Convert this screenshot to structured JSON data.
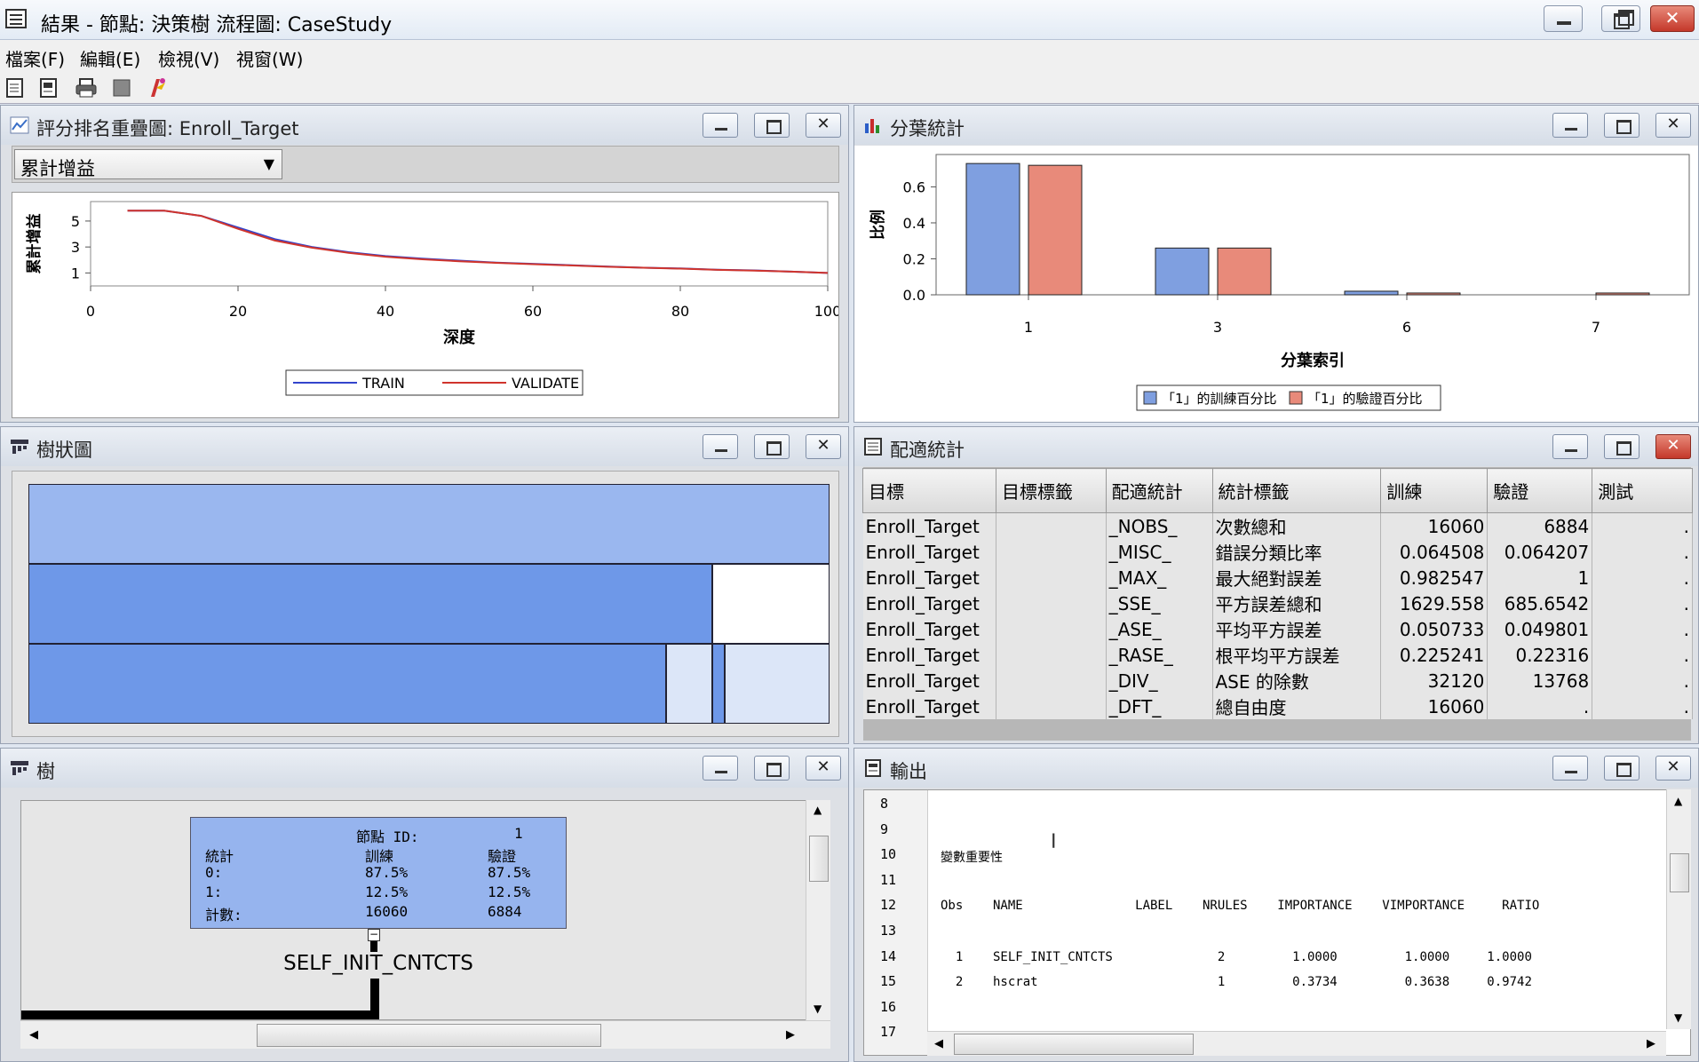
{
  "app": {
    "title": "結果 - 節點: 決策樹  流程圖: CaseStudy"
  },
  "menu": [
    "檔案(F)",
    "編輯(E)",
    "檢視(V)",
    "視窗(W)"
  ],
  "panels": {
    "lift": {
      "title": "評分排名重疊圖: Enroll_Target",
      "dropdown": "累計增益",
      "chart_data": {
        "type": "line",
        "xlabel": "深度",
        "ylabel": "累計增益",
        "x": [
          5,
          10,
          15,
          20,
          25,
          30,
          35,
          40,
          45,
          50,
          55,
          60,
          65,
          70,
          75,
          80,
          85,
          90,
          95,
          100
        ],
        "series": [
          {
            "name": "TRAIN",
            "color": "#3344cc",
            "values": [
              5.8,
              5.8,
              5.4,
              4.5,
              3.6,
              3.0,
              2.6,
              2.3,
              2.1,
              1.95,
              1.8,
              1.7,
              1.6,
              1.5,
              1.4,
              1.35,
              1.25,
              1.2,
              1.1,
              1.0
            ]
          },
          {
            "name": "VALIDATE",
            "color": "#d0342c",
            "values": [
              5.8,
              5.8,
              5.4,
              4.4,
              3.5,
              2.95,
              2.55,
              2.25,
              2.05,
              1.9,
              1.78,
              1.68,
              1.58,
              1.48,
              1.4,
              1.33,
              1.24,
              1.18,
              1.1,
              1.0
            ]
          }
        ],
        "xticks": [
          "0",
          "20",
          "40",
          "60",
          "80",
          "100"
        ],
        "yticks": [
          "1",
          "3",
          "5"
        ],
        "xlim": [
          0,
          100
        ],
        "ylim": [
          0,
          6.5
        ]
      }
    },
    "leaf": {
      "title": "分葉統計",
      "chart_data": {
        "type": "bar",
        "xlabel": "分葉索引",
        "ylabel": "比例",
        "categories": [
          "1",
          "3",
          "6",
          "7"
        ],
        "series": [
          {
            "name": "「1」的訓練百分比",
            "color": "#7f9fe0",
            "values": [
              0.73,
              0.26,
              0.02,
              0.0
            ]
          },
          {
            "name": "「1」的驗證百分比",
            "color": "#e88a7a",
            "values": [
              0.72,
              0.26,
              0.01,
              0.01
            ]
          }
        ],
        "yticks": [
          "0.0",
          "0.2",
          "0.4",
          "0.6"
        ],
        "ylim": [
          0,
          0.78
        ]
      }
    },
    "treemap": {
      "title": "樹狀圖"
    },
    "fit": {
      "title": "配適統計",
      "columns": [
        "目標",
        "目標標籤",
        "配適統計",
        "統計標籤",
        "訓練",
        "驗證",
        "測試"
      ],
      "rows": [
        [
          "Enroll_Target",
          "",
          "_NOBS_",
          "次數總和",
          "16060",
          "6884",
          "."
        ],
        [
          "Enroll_Target",
          "",
          "_MISC_",
          "錯誤分類比率",
          "0.064508",
          "0.064207",
          "."
        ],
        [
          "Enroll_Target",
          "",
          "_MAX_",
          "最大絕對誤差",
          "0.982547",
          "1",
          "."
        ],
        [
          "Enroll_Target",
          "",
          "_SSE_",
          "平方誤差總和",
          "1629.558",
          "685.6542",
          "."
        ],
        [
          "Enroll_Target",
          "",
          "_ASE_",
          "平均平方誤差",
          "0.050733",
          "0.049801",
          "."
        ],
        [
          "Enroll_Target",
          "",
          "_RASE_",
          "根平均平方誤差",
          "0.225241",
          "0.22316",
          "."
        ],
        [
          "Enroll_Target",
          "",
          "_DIV_",
          "ASE 的除數",
          "32120",
          "13768",
          "."
        ],
        [
          "Enroll_Target",
          "",
          "_DFT_",
          "總自由度",
          "16060",
          ".",
          "."
        ]
      ]
    },
    "tree": {
      "title": "樹",
      "node": {
        "id_label": "節點 ID:",
        "id": "1",
        "head": [
          "統計",
          "訓練",
          "驗證"
        ],
        "rows": [
          [
            "0:",
            "87.5%",
            "87.5%"
          ],
          [
            "1:",
            "12.5%",
            "12.5%"
          ],
          [
            "計數:",
            "16060",
            "6884"
          ]
        ]
      },
      "split_var": "SELF_INIT_CNTCTS"
    },
    "output": {
      "title": "輸出",
      "lines": [
        [
          "8",
          ""
        ],
        [
          "9",
          ""
        ],
        [
          "10",
          "變數重要性"
        ],
        [
          "11",
          ""
        ],
        [
          "12",
          "Obs    NAME               LABEL    NRULES    IMPORTANCE    VIMPORTANCE     RATIO"
        ],
        [
          "13",
          ""
        ],
        [
          "14",
          "  1    SELF_INIT_CNTCTS              2         1.0000         1.0000     1.0000"
        ],
        [
          "15",
          "  2    hscrat                        1         0.3734         0.3638     0.9742"
        ],
        [
          "16",
          ""
        ],
        [
          "17",
          ""
        ]
      ]
    }
  },
  "colors": {
    "bar_train": "#7f9fe0",
    "bar_validate": "#e88a7a",
    "treemap_fill": "#6e98e8",
    "treemap_light": "#9ab7ef",
    "treemap_pale": "#dce6f8"
  }
}
